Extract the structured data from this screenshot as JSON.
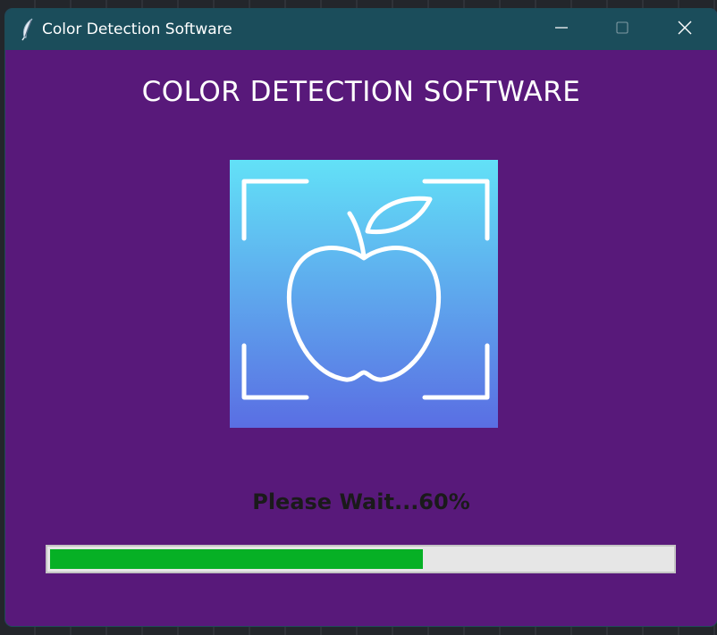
{
  "window": {
    "title": "Color Detection Software",
    "icon": "feather-icon",
    "controls": {
      "minimize": "minimize-icon",
      "maximize": "maximize-icon",
      "close": "close-icon"
    }
  },
  "main": {
    "heading": "COLOR DETECTION SOFTWARE",
    "logo": {
      "icon": "apple-scan-icon",
      "gradient_top": "#62e1f7",
      "gradient_bottom": "#5a6ee3"
    },
    "status_text": "Please Wait...60%",
    "progress": {
      "percent": 60,
      "fill_color": "#06b025",
      "track_color": "#e6e6e6"
    }
  },
  "colors": {
    "background": "#58197a",
    "titlebar": "#1b4d5b"
  }
}
